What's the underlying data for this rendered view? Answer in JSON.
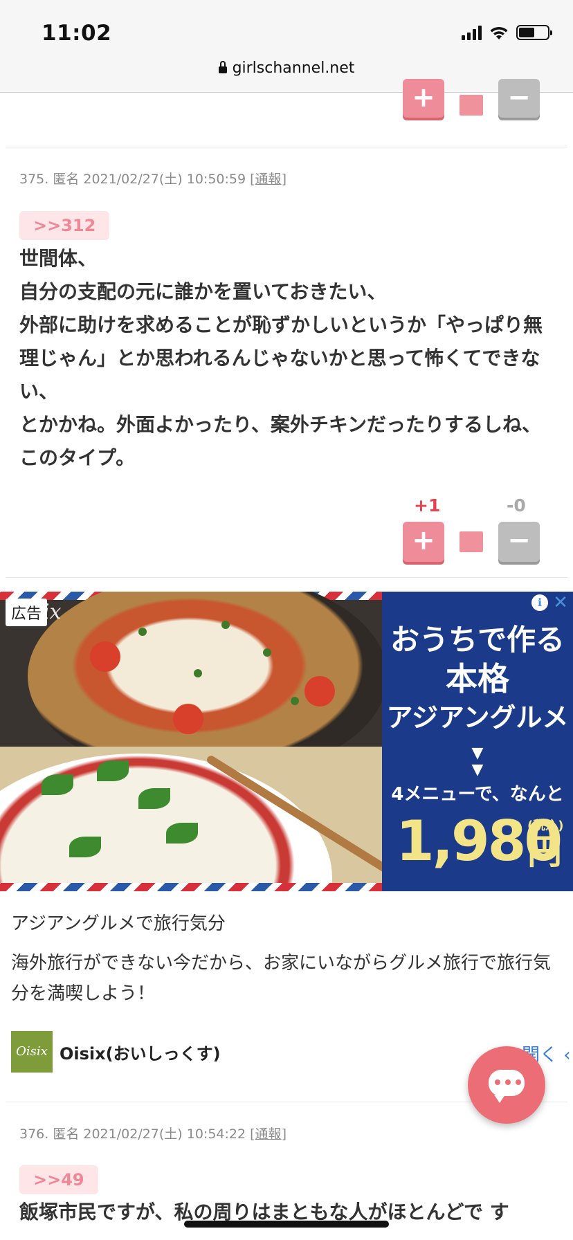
{
  "status_bar": {
    "time": "11:02"
  },
  "browser": {
    "url": "girlschannel.net"
  },
  "vote": {
    "plus": "+",
    "minus": "−"
  },
  "comment_375": {
    "meta": "375. 匿名 2021/02/27(土) 10:50:59 [",
    "report": "通報",
    "meta_end": "]",
    "anchor": ">>312",
    "body": "世間体、\n自分の支配の元に誰かを置いておきたい、\n外部に助けを求めることが恥ずかしいというか「やっぱり無理じゃん」とか思われるんじゃないかと思って怖くてできない、\nとかかね。外面よかったり、案外チキンだったりするしね、このタイプ。",
    "plus_count": "+1",
    "minus_count": "-0"
  },
  "ad": {
    "label": "広告",
    "brand_overlay": "ix",
    "info_icon": "i",
    "close_icon": "✕",
    "panel_line1": "おうちで作る",
    "panel_line2": "本格",
    "panel_line3": "アジアングルメ",
    "panel_arrow": "⌄\n⌄",
    "panel_line4": "4メニューで、なんと",
    "price": "1,980",
    "tax": "(税込)",
    "yen": "円",
    "title": "アジアングルメで旅行気分",
    "description": "海外旅行ができない今だから、お家にいながらグルメ旅行で旅行気分を満喫しよう！",
    "logo_text": "Oisix",
    "brand_name": "Oisix(おいしっくす)",
    "open_label": "開く"
  },
  "comment_376": {
    "meta": "376. 匿名 2021/02/27(土) 10:54:22 [",
    "report": "通報",
    "meta_end": "]",
    "anchor": ">>49",
    "body": "飯塚市民ですが、私の周りはまともな人がほとんどで す"
  },
  "colors": {
    "vote_plus": "#ef8c99",
    "vote_minus": "#bdbdbd",
    "anchor_bg": "#fde5e8",
    "ad_panel": "#1c3a8a",
    "price": "#f3e487",
    "fab": "#ec6d76"
  }
}
